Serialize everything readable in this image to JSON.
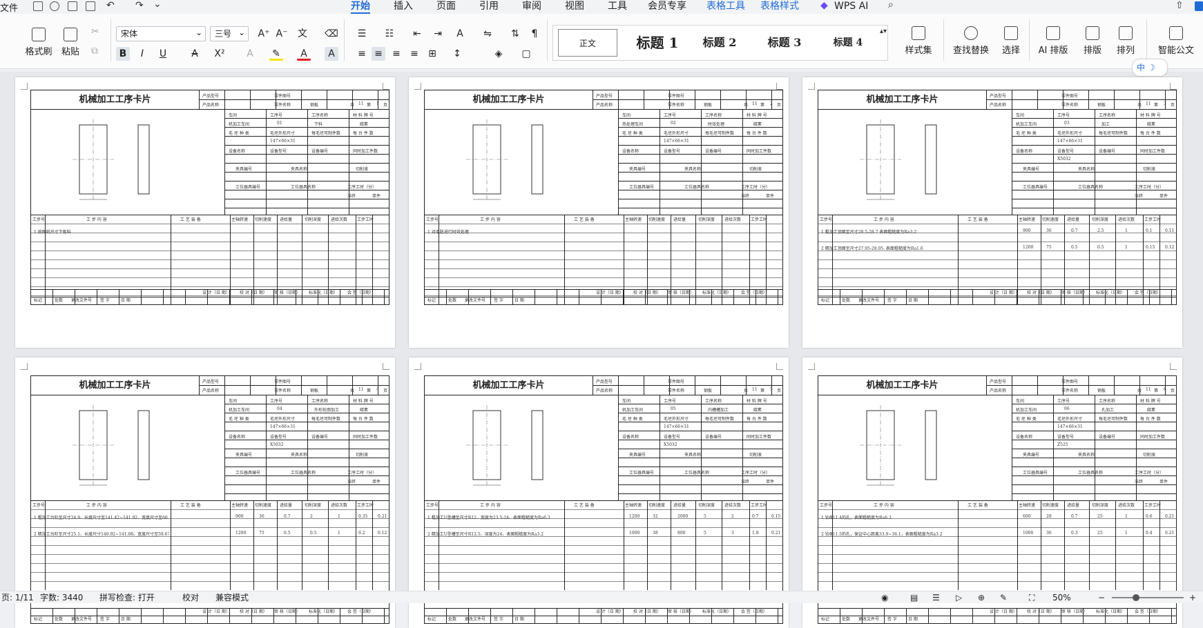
{
  "topbar": {
    "file_label": "文件",
    "tabs": [
      "开始",
      "插入",
      "页面",
      "引用",
      "审阅",
      "视图",
      "工具",
      "会员专享"
    ],
    "context_tabs": [
      "表格工具",
      "表格样式"
    ],
    "wps_ai": "WPS AI",
    "active_tab": "开始"
  },
  "ribbon": {
    "format_painter": "格式刷",
    "paste": "粘贴",
    "font_name": "宋体",
    "font_size": "三号",
    "styles": [
      "正文",
      "标题 1",
      "标题 2",
      "标题 3",
      "标题 4"
    ],
    "style_set": "样式集",
    "find_replace": "查找替换",
    "select": "选择",
    "ai_layout": "AI 排版",
    "layout": "排版",
    "arrange": "排列",
    "smart_doc": "智能公文"
  },
  "document": {
    "card_title": "机械加工工序卡片",
    "header_labels": [
      "产品型号",
      "零件图号",
      "产品名称",
      "零件名称",
      "钢板",
      "共",
      "11",
      "页",
      "第",
      "页"
    ],
    "info_labels": [
      "车间",
      "工序号",
      "工序名称",
      "材 料 牌 号",
      "毛 坯 种 类",
      "毛坯外形尺寸",
      "每毛坯可制件数",
      "每 台 件 数",
      "设备名称",
      "设备型号",
      "设备编号",
      "同时加工件数",
      "夹具编号",
      "夹具名称",
      "切削液",
      "工位器具编号",
      "工位器具名称",
      "工序工时（分）",
      "准终",
      "单件"
    ],
    "op_headers": [
      "工步号",
      "工 步 内 容",
      "工 艺 装 备",
      "主轴转速",
      "切削速度",
      "进给量",
      "切削深度",
      "进给次数",
      "工步工时"
    ],
    "foot_labels": [
      "设 计（日 期）",
      "校 对（日 期）",
      "审 核（日期）",
      "标准化（日期）",
      "会 签（日期）",
      "标记",
      "处数",
      "更改文件号",
      "签 字",
      "日 期"
    ],
    "pages": [
      {
        "page_no": "1",
        "shop": "机加工车间",
        "op_no": "01",
        "op_name": "下料",
        "material": "碳素",
        "blank": "147×66×31",
        "steps": [
          "1  按图纸尺寸下板料"
        ]
      },
      {
        "page_no": "2",
        "shop": "热处理车间",
        "op_no": "02",
        "op_name": "时效处理",
        "material": "碳素",
        "blank": "147×66×31",
        "steps": [
          "1  对毛胚进行时效处理"
        ]
      },
      {
        "page_no": "3",
        "shop": "机加工车间",
        "op_no": "03",
        "op_name": "加工",
        "material": "碳素",
        "blank": "147×66×31",
        "equip": "X5032",
        "steps": [
          "1  粗加工顶面至尺寸28.5-28.7 表面粗糙度为Ra3.2",
          "2  精加工顶面至尺寸27.95-28.05. 表面粗糙度为Ra1.6"
        ],
        "vals": [
          [
            "900",
            "36",
            "0.7",
            "2.5",
            "1",
            "0.1",
            "0.11"
          ],
          [
            "1200",
            "75",
            "0.5",
            "0.5",
            "1",
            "0.15",
            "0.12"
          ]
        ]
      },
      {
        "page_no": "4",
        "shop": "机加工车间",
        "op_no": "04",
        "op_name": "外形轮廓加工",
        "material": "碳素",
        "blank": "147×66×31",
        "equip": "X5032",
        "steps": [
          "1  粗加工台阶至尺寸24.9、长度尺寸至141.42~141.92、宽度尺寸至60.17-60.8",
          "2  精加工台阶至尺寸25.1、长度尺寸140.92~141.08、宽度尺寸至59.67-59.86"
        ],
        "vals": [
          [
            "900",
            "36",
            "0.7",
            "2",
            "1",
            "0.35",
            "0.21"
          ],
          [
            "1200",
            "75",
            "0.5",
            "0.5",
            "1",
            "0.2",
            "0.12"
          ]
        ]
      },
      {
        "page_no": "5",
        "shop": "机加工车间",
        "op_no": "05",
        "op_name": "内槽槽加工",
        "material": "碳素",
        "blank": "147×66×31",
        "equip": "X5032",
        "steps": [
          "1  粗加工U型槽至尺寸R12、宽度为23.5-24、表面粗糙度为Ra6.3",
          "2  精加工U型槽至尺寸R12.5、深度为24、表面粗糙度为Ra3.2"
        ],
        "vals": [
          [
            "1200",
            "32",
            "2000",
            "5",
            "2",
            "0.7",
            "0.15"
          ],
          [
            "1000",
            "38",
            "800",
            "5",
            "3",
            "1.8",
            "0.21"
          ]
        ]
      },
      {
        "page_no": "6",
        "shop": "机加工车间",
        "op_no": "06",
        "op_name": "孔加工",
        "material": "碳素",
        "blank": "147×66×31",
        "equip": "Z525",
        "steps": [
          "1  钻Φ11.4的孔，表面粗糙度为Ra6.3",
          "2  铰Φ11.5的孔，保证中心距离33.9~36.1，表面粗糙度为Ra3.2"
        ],
        "vals": [
          [
            "600",
            "28",
            "0.7",
            "25",
            "1",
            "0.6",
            "0.21"
          ],
          [
            "1000",
            "36",
            "0.3",
            "25",
            "1",
            "0.4",
            "0.21"
          ]
        ]
      }
    ]
  },
  "status": {
    "page": "页: 1/11",
    "words": "字数: 3440",
    "spell": "拼写检查: 打开",
    "proof": "校对",
    "compat": "兼容模式",
    "zoom": "50%"
  }
}
